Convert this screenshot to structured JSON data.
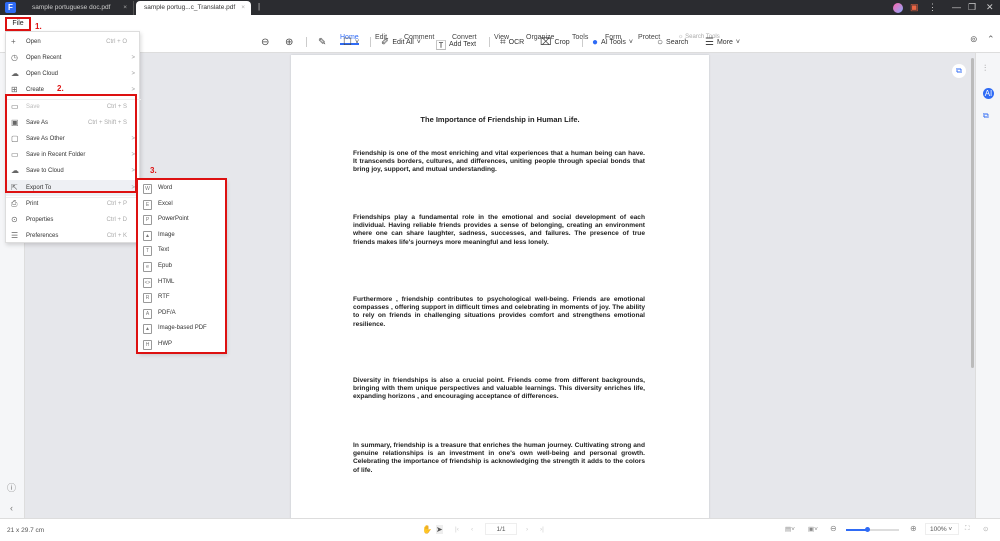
{
  "tabs": [
    {
      "label": "sample portuguese doc.pdf"
    },
    {
      "label": "sample portug...c_Translate.pdf"
    }
  ],
  "file_label": "File",
  "annotations": [
    "1.",
    "2.",
    "3."
  ],
  "menu_tabs": [
    "Home",
    "Edit",
    "Comment",
    "Convert",
    "View",
    "Organize",
    "Tools",
    "Form",
    "Protect"
  ],
  "search_tools": "Search Tools",
  "tools": {
    "edit_all": "Edit All",
    "add_text": "Add Text",
    "ocr": "OCR",
    "crop": "Crop",
    "ai_tools": "AI Tools",
    "search": "Search",
    "more": "More"
  },
  "file_menu": [
    {
      "label": "Open",
      "shortcut": "Ctrl + O",
      "icon": "+"
    },
    {
      "label": "Open Recent",
      "arrow": ">",
      "icon": "◷"
    },
    {
      "label": "Open Cloud",
      "arrow": ">",
      "icon": "☁"
    },
    {
      "label": "Create",
      "arrow": ">",
      "icon": "⊞"
    },
    {
      "label": "Save",
      "shortcut": "Ctrl + S",
      "icon": "▭"
    },
    {
      "label": "Save As",
      "shortcut": "Ctrl + Shift + S",
      "icon": "▣"
    },
    {
      "label": "Save As Other",
      "arrow": ">",
      "icon": "▢"
    },
    {
      "label": "Save in Recent Folder",
      "arrow": ">",
      "icon": "▭"
    },
    {
      "label": "Save to Cloud",
      "arrow": ">",
      "icon": "☁"
    },
    {
      "label": "Export To",
      "arrow": ">",
      "icon": "⇱"
    },
    {
      "label": "Print",
      "shortcut": "Ctrl + P",
      "icon": "⎙"
    },
    {
      "label": "Properties",
      "shortcut": "Ctrl + D",
      "icon": "⊙"
    },
    {
      "label": "Preferences",
      "shortcut": "Ctrl + K",
      "icon": "☰"
    }
  ],
  "export_menu": [
    {
      "label": "Word",
      "icon": "W"
    },
    {
      "label": "Excel",
      "icon": "E"
    },
    {
      "label": "PowerPoint",
      "icon": "P"
    },
    {
      "label": "Image",
      "icon": "▲"
    },
    {
      "label": "Text",
      "icon": "T"
    },
    {
      "label": "Epub",
      "icon": "e"
    },
    {
      "label": "HTML",
      "icon": "<>"
    },
    {
      "label": "RTF",
      "icon": "R"
    },
    {
      "label": "PDF/A",
      "icon": "A"
    },
    {
      "label": "Image-based PDF",
      "icon": "▲"
    },
    {
      "label": "HWP",
      "icon": "H"
    }
  ],
  "document": {
    "title": "The Importance of Friendship in Human Life.",
    "paragraphs": [
      "Friendship is one of the most enriching and vital experiences that a human being can have. It transcends borders, cultures, and differences, uniting people through special bonds that bring joy, support, and mutual understanding.",
      "Friendships play a fundamental role in the emotional and social development of each individual. Having reliable friends provides a sense of belonging, creating an environment where one can share laughter, sadness, successes, and failures. The presence of true friends makes life's journeys more meaningful and less lonely.",
      "Furthermore , friendship contributes to psychological well-being. Friends are emotional compasses , offering support in difficult times and celebrating in moments of joy. The ability to rely on friends in challenging situations provides comfort and strengthens emotional resilience.",
      "Diversity in friendships is also a crucial point. Friends come from different backgrounds, bringing with them unique perspectives and valuable learnings. This diversity enriches life, expanding horizons , and encouraging acceptance of differences.",
      "In summary, friendship is a treasure that enriches the human journey. Cultivating strong and genuine relationships is an investment in one's own well-being and personal growth. Celebrating the importance of friendship is acknowledging the strength it adds to the colors of life."
    ]
  },
  "status": {
    "page_size": "21 x 29.7 cm",
    "page": "1/1",
    "zoom": "100%",
    "zoom_level": 0.4
  }
}
